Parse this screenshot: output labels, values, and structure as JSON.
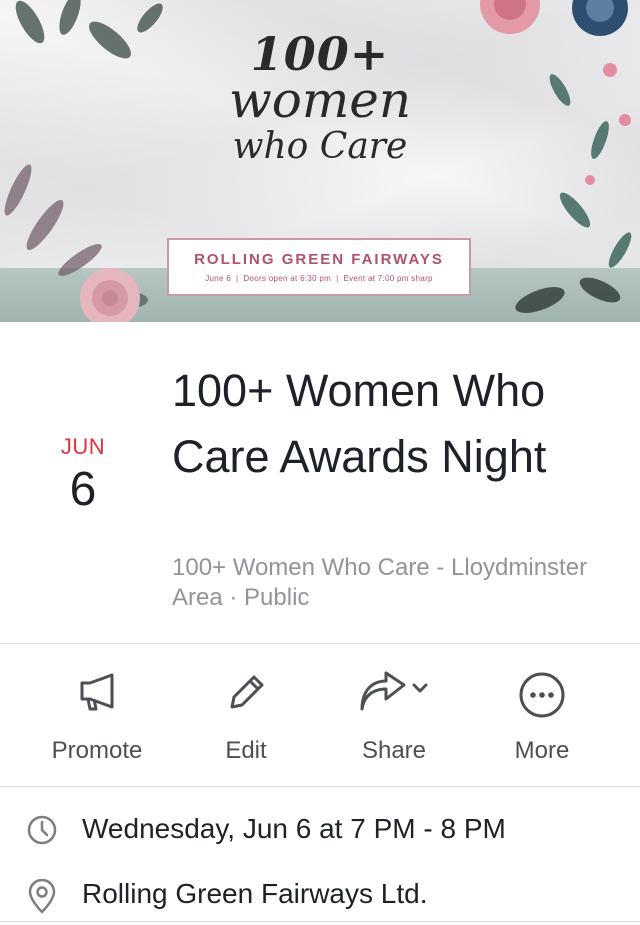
{
  "cover": {
    "title_line1": "100+",
    "title_line2": "women",
    "title_line3": "who Care",
    "venue_name": "ROLLING GREEN FAIRWAYS",
    "venue_date": "June 6",
    "venue_doors": "Doors open at 6:30 pm",
    "venue_event": "Event at 7:00 pm sharp",
    "colors": {
      "accent": "#b0526a",
      "band": "#a9bbb7"
    }
  },
  "event": {
    "month": "JUN",
    "day": "6",
    "title": "100+ Women Who Care Awards Night",
    "host": "100+ Women Who Care - Lloydminster Area",
    "privacy": "Public"
  },
  "actions": [
    {
      "label": "Promote",
      "icon": "megaphone-icon"
    },
    {
      "label": "Edit",
      "icon": "pencil-icon"
    },
    {
      "label": "Share",
      "icon": "share-arrow-icon"
    },
    {
      "label": "More",
      "icon": "more-dots-icon"
    }
  ],
  "details": {
    "time": "Wednesday, Jun 6 at 7 PM - 8 PM",
    "location": "Rolling Green Fairways Ltd."
  }
}
